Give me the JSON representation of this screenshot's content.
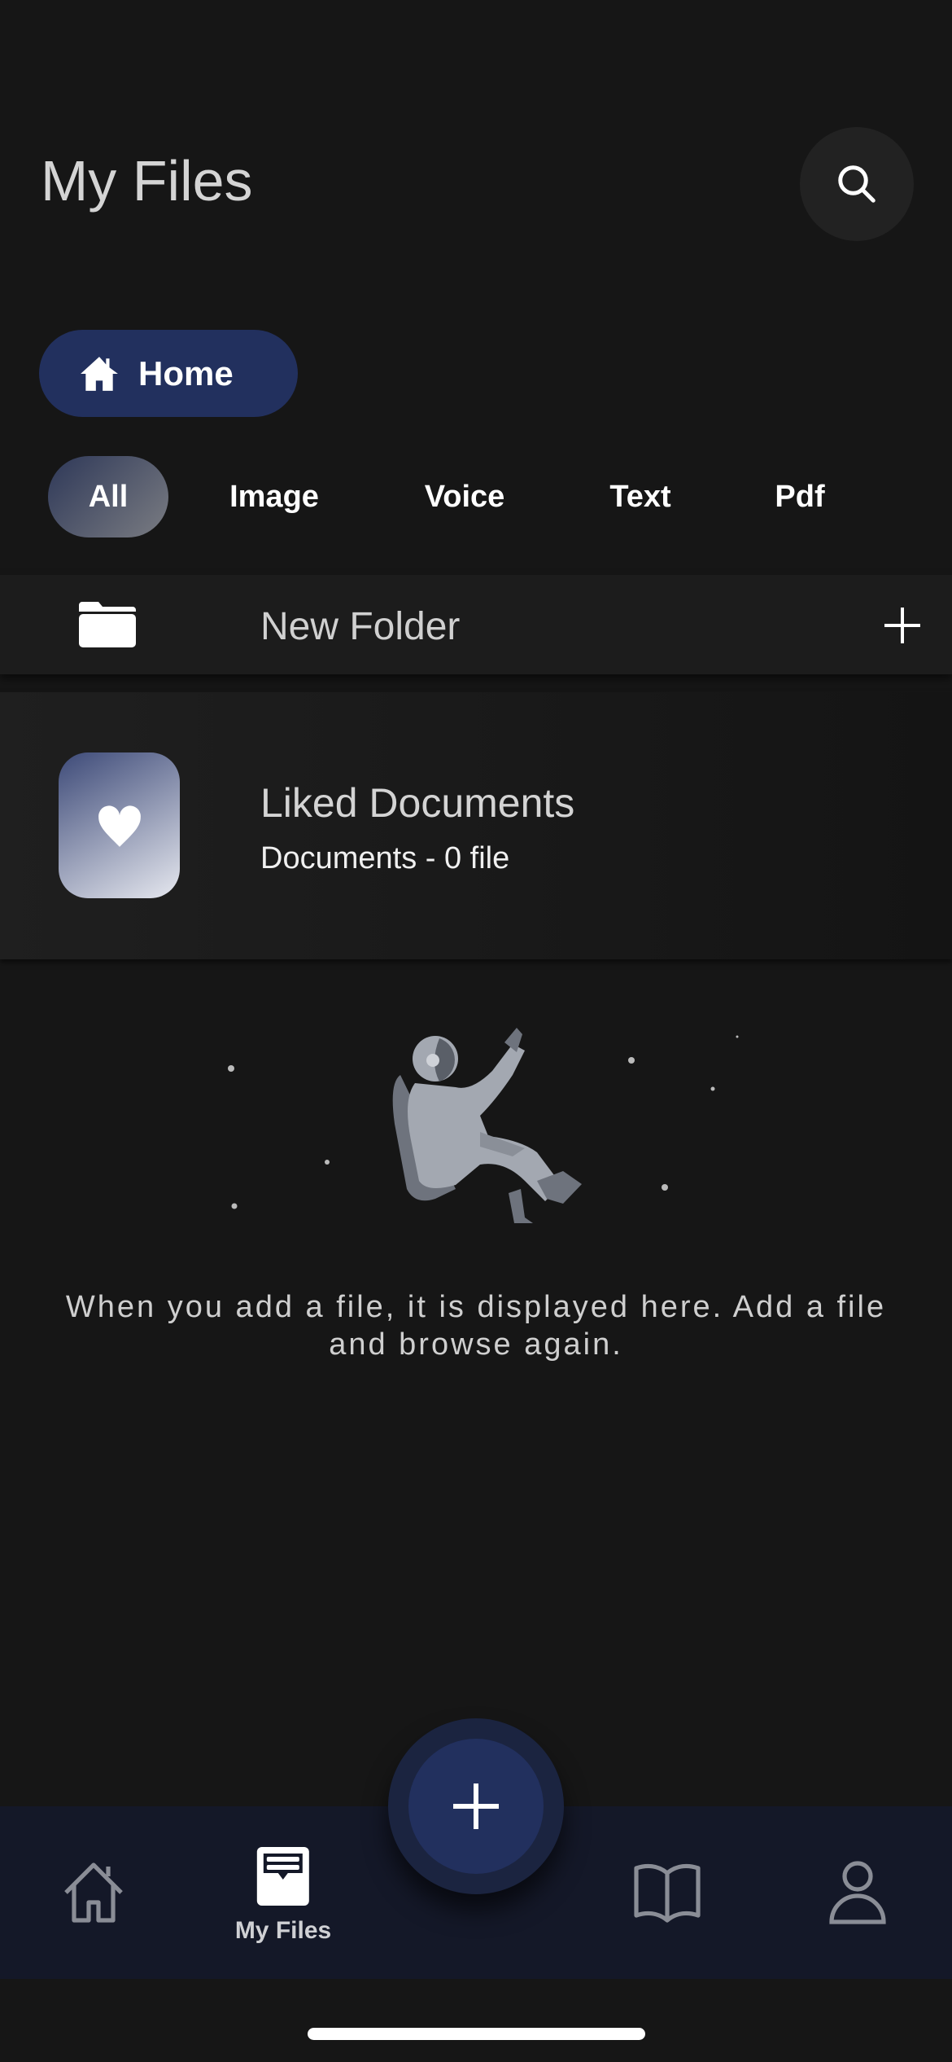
{
  "header": {
    "title": "My Files",
    "search_icon": "search-icon"
  },
  "location": {
    "label": "Home",
    "icon": "home-icon",
    "color": "#22305e"
  },
  "filters": [
    {
      "label": "All",
      "selected": true
    },
    {
      "label": "Image"
    },
    {
      "label": "Voice"
    },
    {
      "label": "Text"
    },
    {
      "label": "Pdf"
    }
  ],
  "new_folder": {
    "label": "New Folder",
    "icon": "folder-icon",
    "action_icon": "plus-icon"
  },
  "liked": {
    "title": "Liked Documents",
    "subtitle": "Documents - 0 file",
    "icon": "heart-icon"
  },
  "empty_state": {
    "message": "When you add a file, it is displayed here. Add a file and browse again.",
    "illustration": "astronaut"
  },
  "nav": {
    "items": [
      {
        "icon": "home-icon"
      },
      {
        "icon": "file-tray-icon",
        "label": "My Files",
        "active": true
      },
      {
        "icon": "book-icon"
      },
      {
        "icon": "person-icon"
      }
    ],
    "fab_icon": "plus-icon",
    "accent": "#22305e"
  }
}
